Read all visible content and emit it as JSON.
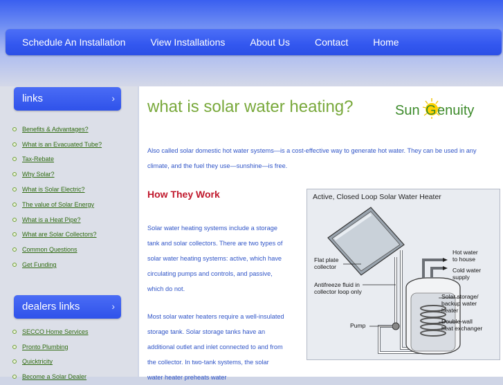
{
  "nav": {
    "items": [
      {
        "label": "Schedule An Installation"
      },
      {
        "label": "View Installations"
      },
      {
        "label": "About Us"
      },
      {
        "label": "Contact"
      },
      {
        "label": "Home"
      }
    ]
  },
  "sidebar": {
    "links_heading": "links",
    "chevron": "›",
    "links": [
      "Benefits & Advantages?",
      "What is an Evacuated Tube?",
      "Tax-Rebate",
      "Why Solar?",
      "What is Solar Electric?",
      "The value of Solar Energy",
      "What is a Heat Pipe?",
      "What are Solar Collectors?",
      "Common Questions",
      "Get Funding"
    ],
    "dealers_heading": "dealers links",
    "dealers": [
      "SECCO Home Services",
      "Pronto Plumbing",
      "Quicktricity",
      "Become a Solar Dealer"
    ]
  },
  "main": {
    "title": "what is solar water heating?",
    "logo": {
      "part1": "Sun",
      "part2": "G",
      "part3": "enuity"
    },
    "intro": "Also called solar domestic hot water systems—is a cost-effective way to generate hot water. They can be used in any climate, and the fuel they use—sunshine—is free.",
    "subheading": "How They Work",
    "para1": "Solar water heating systems include a storage tank and solar collectors. There are two types of solar water heating systems: active, which have circulating pumps and controls, and passive, which do not.",
    "para2": "Most solar water heaters require a well-insulated storage tank. Solar storage tanks have an additional outlet and inlet connected to and from the collector. In two-tank systems, the solar water heater preheats water"
  },
  "diagram": {
    "title": "Active, Closed Loop Solar Water Heater",
    "labels": {
      "flat_plate": "Flat plate\ncollector",
      "antifreeze": "Antifreeze fluid in\ncollector loop only",
      "pump": "Pump",
      "hot_water": "Hot water\nto house",
      "cold_water": "Cold water\nsupply",
      "storage": "Solar storage/\nbackup water\nheater",
      "exchanger": "Double-wall\nheat exchanger"
    }
  },
  "colors": {
    "nav_blue": "#3357ef",
    "title_green": "#78a83a",
    "body_blue": "#2f54c7",
    "subheading_red": "#c0182c",
    "link_green": "#2f6b10"
  }
}
